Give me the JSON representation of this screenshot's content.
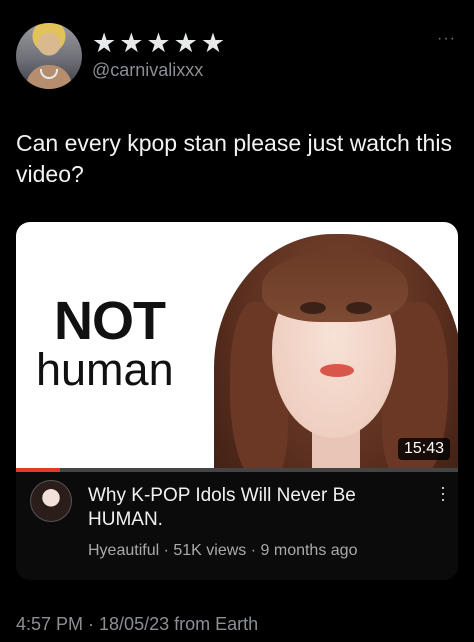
{
  "author": {
    "display_name": "★★★★★",
    "handle": "@carnivalixxx"
  },
  "more_icon": "more-dots-icon",
  "tweet": {
    "text": "Can every kpop stan please just watch this video?"
  },
  "video_card": {
    "thumbnail_text_line1": "NOT",
    "thumbnail_text_line2": "human",
    "duration": "15:43",
    "progress_fraction": 0.1,
    "title": "Why K-POP Idols Will Never Be HUMAN.",
    "channel": "Hyeautiful",
    "meta": " · 51K views · 9 months ago",
    "menu_icon": "vertical-dots-icon",
    "accent_color": "#e3382c"
  },
  "footer": {
    "timestamp": "4:57 PM · 18/05/23 from Earth"
  }
}
